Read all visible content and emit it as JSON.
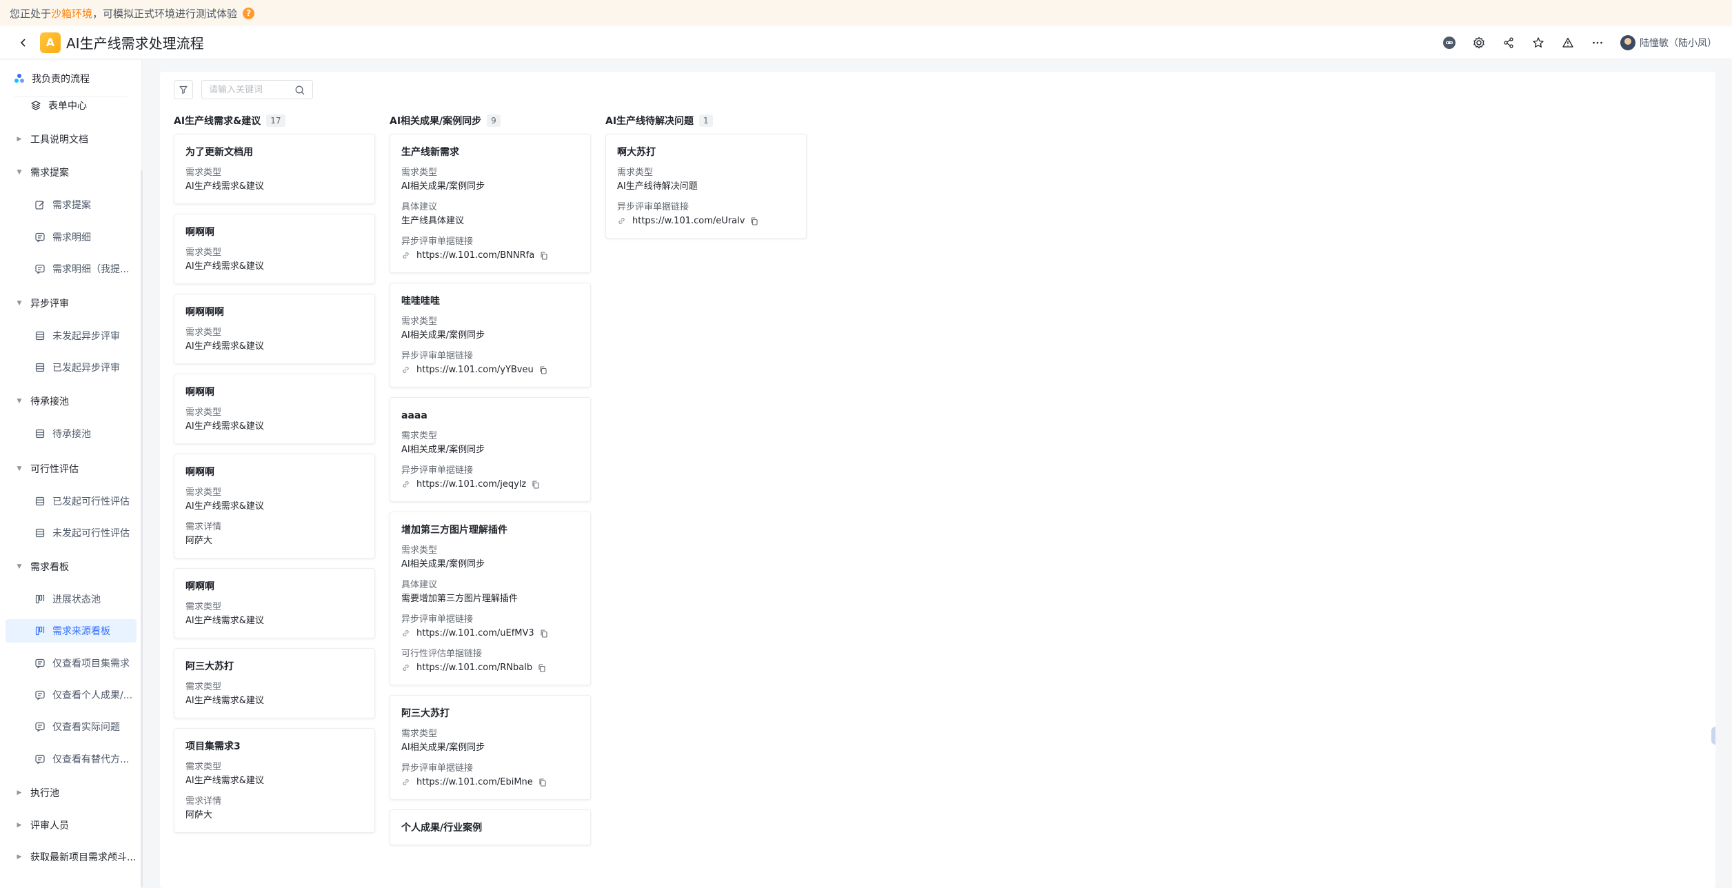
{
  "banner": {
    "prefix": "您正处于",
    "highlight": "沙箱环境",
    "suffix": "，可模拟正式环境进行测试体验",
    "help": "?"
  },
  "header": {
    "logo": "A",
    "title": "AI生产线需求处理流程",
    "user_name": "陆憧敏（陆小凤）"
  },
  "sidebar": {
    "top_item": "我负责的流程",
    "items": [
      {
        "label": "表单中心",
        "level": 1,
        "icon": "layers-icon",
        "caret": ""
      },
      {
        "label": "工具说明文档",
        "level": 1,
        "caret": "▶"
      },
      {
        "label": "需求提案",
        "level": 1,
        "caret": "▼"
      },
      {
        "label": "需求提案",
        "level": 2,
        "icon": "edit-icon"
      },
      {
        "label": "需求明细",
        "level": 2,
        "icon": "message-icon"
      },
      {
        "label": "需求明细（我提...",
        "level": 2,
        "icon": "message-icon"
      },
      {
        "label": "异步评审",
        "level": 1,
        "caret": "▼"
      },
      {
        "label": "未发起异步评审",
        "level": 2,
        "icon": "table-icon"
      },
      {
        "label": "已发起异步评审",
        "level": 2,
        "icon": "table-icon"
      },
      {
        "label": "待承接池",
        "level": 1,
        "caret": "▼"
      },
      {
        "label": "待承接池",
        "level": 2,
        "icon": "table-icon"
      },
      {
        "label": "可行性评估",
        "level": 1,
        "caret": "▼"
      },
      {
        "label": "已发起可行性评估",
        "level": 2,
        "icon": "table-icon"
      },
      {
        "label": "未发起可行性评估",
        "level": 2,
        "icon": "table-icon"
      },
      {
        "label": "需求看板",
        "level": 1,
        "caret": "▼"
      },
      {
        "label": "进展状态池",
        "level": 2,
        "icon": "kanban-icon"
      },
      {
        "label": "需求来源看板",
        "level": 2,
        "icon": "kanban-icon",
        "active": true
      },
      {
        "label": "仅查看项目集需求",
        "level": 2,
        "icon": "message-icon"
      },
      {
        "label": "仅查看个人成果/...",
        "level": 2,
        "icon": "message-icon"
      },
      {
        "label": "仅查看实际问题",
        "level": 2,
        "icon": "message-icon"
      },
      {
        "label": "仅查看有替代方...",
        "level": 2,
        "icon": "message-icon"
      },
      {
        "label": "执行池",
        "level": 1,
        "caret": "▶"
      },
      {
        "label": "评审人员",
        "level": 1,
        "caret": "▶"
      },
      {
        "label": "获取最新项目需求颅斗...",
        "level": 1,
        "caret": "▶"
      }
    ]
  },
  "toolbar": {
    "search_placeholder": "请输入关键词"
  },
  "board": {
    "columns": [
      {
        "title": "AI生产线需求&建议",
        "count": "17",
        "cards": [
          {
            "title": "为了更新文档用",
            "fields": [
              {
                "label": "需求类型",
                "value": "AI生产线需求&建议"
              }
            ]
          },
          {
            "title": "啊啊啊",
            "fields": [
              {
                "label": "需求类型",
                "value": "AI生产线需求&建议"
              }
            ]
          },
          {
            "title": "啊啊啊啊",
            "fields": [
              {
                "label": "需求类型",
                "value": "AI生产线需求&建议"
              }
            ]
          },
          {
            "title": "啊啊啊",
            "fields": [
              {
                "label": "需求类型",
                "value": "AI生产线需求&建议"
              }
            ]
          },
          {
            "title": "啊啊啊",
            "fields": [
              {
                "label": "需求类型",
                "value": "AI生产线需求&建议"
              },
              {
                "label": "需求详情",
                "value": "阿萨大"
              }
            ]
          },
          {
            "title": "啊啊啊",
            "fields": [
              {
                "label": "需求类型",
                "value": "AI生产线需求&建议"
              }
            ]
          },
          {
            "title": "阿三大苏打",
            "fields": [
              {
                "label": "需求类型",
                "value": "AI生产线需求&建议"
              }
            ]
          },
          {
            "title": "项目集需求3",
            "fields": [
              {
                "label": "需求类型",
                "value": "AI生产线需求&建议"
              },
              {
                "label": "需求详情",
                "value": "阿萨大"
              }
            ]
          }
        ]
      },
      {
        "title": "AI相关成果/案例同步",
        "count": "9",
        "cards": [
          {
            "title": "生产线新需求",
            "fields": [
              {
                "label": "需求类型",
                "value": "AI相关成果/案例同步"
              },
              {
                "label": "具体建议",
                "value": "生产线具体建议"
              },
              {
                "label": "异步评审单据链接",
                "link": "https://w.101.com/BNNRfa"
              }
            ]
          },
          {
            "title": "哇哇哇哇",
            "fields": [
              {
                "label": "需求类型",
                "value": "AI相关成果/案例同步"
              },
              {
                "label": "异步评审单据链接",
                "link": "https://w.101.com/yYBveu"
              }
            ]
          },
          {
            "title": "aaaa",
            "fields": [
              {
                "label": "需求类型",
                "value": "AI相关成果/案例同步"
              },
              {
                "label": "异步评审单据链接",
                "link": "https://w.101.com/jeqylz"
              }
            ]
          },
          {
            "title": "增加第三方图片理解插件",
            "fields": [
              {
                "label": "需求类型",
                "value": "AI相关成果/案例同步"
              },
              {
                "label": "具体建议",
                "value": "需要增加第三方图片理解插件"
              },
              {
                "label": "异步评审单据链接",
                "link": "https://w.101.com/uEfMV3"
              },
              {
                "label": "可行性评估单据链接",
                "link": "https://w.101.com/RNbalb"
              }
            ]
          },
          {
            "title": "阿三大苏打",
            "fields": [
              {
                "label": "需求类型",
                "value": "AI相关成果/案例同步"
              },
              {
                "label": "异步评审单据链接",
                "link": "https://w.101.com/EbiMne"
              }
            ]
          },
          {
            "title": "个人成果/行业案例",
            "fields": []
          }
        ]
      },
      {
        "title": "AI生产线待解决问题",
        "count": "1",
        "cards": [
          {
            "title": "啊大苏打",
            "fields": [
              {
                "label": "需求类型",
                "value": "AI生产线待解决问题"
              },
              {
                "label": "异步评审单据链接",
                "link": "https://w.101.com/eUralv"
              }
            ]
          }
        ]
      }
    ]
  },
  "colors": {
    "accent": "#3370ff",
    "banner_bg": "#fdf6ec",
    "banner_highlight": "#ff7d00",
    "active_bg": "#e8f3ff"
  }
}
